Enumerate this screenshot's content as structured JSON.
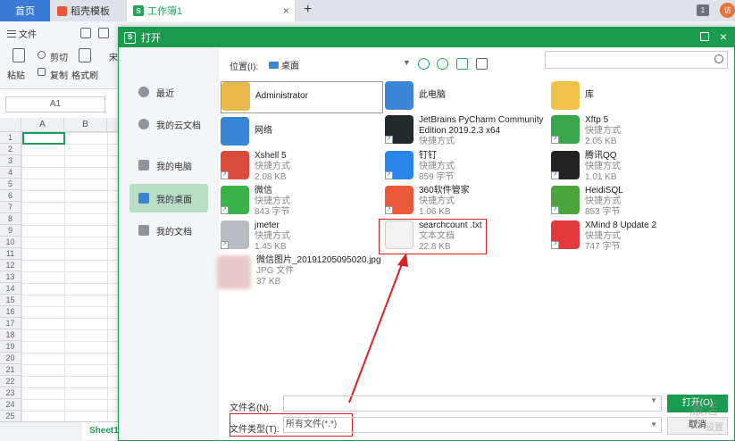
{
  "tabs": {
    "home": "首页",
    "template": "稻壳模板",
    "doc": "工作簿1",
    "doc_icon": "S",
    "close": "×",
    "add": "+",
    "badge": "1",
    "avatar": "访"
  },
  "toolbar": {
    "file": "文件",
    "cut": "剪切",
    "paste": "粘贴",
    "copy": "复制",
    "format_painter": "格式刷",
    "font_partial": "宋"
  },
  "sheet": {
    "namebox": "A1",
    "col_a": "A",
    "col_b": "B",
    "rows": [
      "1",
      "2",
      "3",
      "4",
      "5",
      "6",
      "7",
      "8",
      "9",
      "10",
      "11",
      "12",
      "13",
      "14",
      "15",
      "16",
      "17",
      "18",
      "19",
      "20",
      "21",
      "22",
      "23",
      "24",
      "25"
    ],
    "tab": "Sheet1"
  },
  "dialog": {
    "title": "打开",
    "title_logo": "S",
    "close": "×",
    "sidebar": [
      {
        "label": "最近",
        "icon": "clock-icon"
      },
      {
        "label": "我的云文档",
        "icon": "cloud-icon"
      },
      {
        "label": "我的电脑",
        "icon": "computer-icon"
      },
      {
        "label": "我的桌面",
        "icon": "desktop-icon",
        "active": true
      },
      {
        "label": "我的文档",
        "icon": "folder-icon"
      }
    ],
    "location_label": "位置(I):",
    "location_value": "桌面",
    "files": [
      {
        "name": "Administrator",
        "sub1": "",
        "sub2": "",
        "color": "#e8b84a"
      },
      {
        "name": "此电脑",
        "sub1": "",
        "sub2": "",
        "color": "#3b86d4"
      },
      {
        "name": "库",
        "sub1": "",
        "sub2": "",
        "color": "#f0c24a"
      },
      {
        "name": "网络",
        "sub1": "",
        "sub2": "",
        "color": "#3b86d4"
      },
      {
        "name": "JetBrains PyCharm Community",
        "name2": "Edition 2019.2.3 x64",
        "sub1": "快捷方式",
        "sub2": "",
        "color": "#1f2b2b"
      },
      {
        "name": "Xftp 5",
        "sub1": "快捷方式",
        "sub2": "2.05 KB",
        "color": "#3aa64a"
      },
      {
        "name": "Xshell 5",
        "sub1": "快捷方式",
        "sub2": "2.08 KB",
        "color": "#d94b3a"
      },
      {
        "name": "钉钉",
        "sub1": "快捷方式",
        "sub2": "859 字节",
        "color": "#2a85e8"
      },
      {
        "name": "腾讯QQ",
        "sub1": "快捷方式",
        "sub2": "1.01 KB",
        "color": "#222222"
      },
      {
        "name": "微信",
        "sub1": "快捷方式",
        "sub2": "843 字节",
        "color": "#3cb34a"
      },
      {
        "name": "360软件管家",
        "sub1": "快捷方式",
        "sub2": "1.06 KB",
        "color": "#e85a3a"
      },
      {
        "name": "HeidiSQL",
        "sub1": "快捷方式",
        "sub2": "853 字节",
        "color": "#4aa63a"
      },
      {
        "name": "jmeter",
        "sub1": "快捷方式",
        "sub2": "1.45 KB",
        "color": "#b8bcc2"
      },
      {
        "name": "searchcount .txt",
        "sub1": "文本文档",
        "sub2": "22.8 KB",
        "color": "#f2f2f2"
      },
      {
        "name": "XMind 8 Update 2",
        "sub1": "快捷方式",
        "sub2": "747 字节",
        "color": "#e23a3a"
      },
      {
        "name": "微信图片_20191205095020.jpg",
        "sub1": "JPG 文件",
        "sub2": "37 KB",
        "color": "#e8c8c8"
      }
    ],
    "filename_label": "文件名(N):",
    "filename_value": "",
    "filetype_label": "文件类型(T):",
    "filetype_value": "所有文件(*.*)",
    "open_button": "打开(O)",
    "cancel_button": "取消"
  },
  "watermark": {
    "line1": "激活 W",
    "line2": "设置"
  }
}
